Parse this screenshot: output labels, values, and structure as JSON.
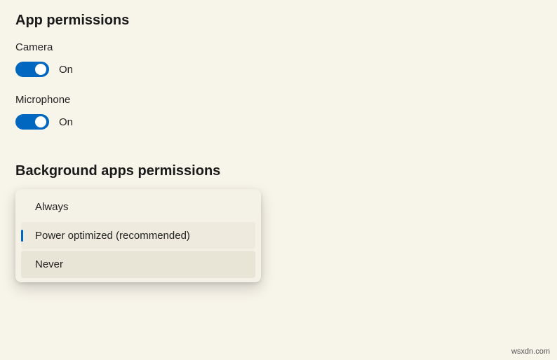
{
  "app_permissions": {
    "title": "App permissions",
    "items": [
      {
        "label": "Camera",
        "state": "On"
      },
      {
        "label": "Microphone",
        "state": "On"
      }
    ]
  },
  "background_apps": {
    "title": "Background apps permissions",
    "options": [
      {
        "label": "Always"
      },
      {
        "label": "Power optimized (recommended)"
      },
      {
        "label": "Never"
      }
    ]
  },
  "watermark": "wsxdn.com"
}
